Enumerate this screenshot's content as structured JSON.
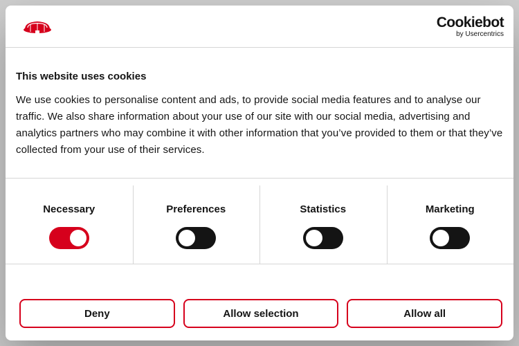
{
  "colors": {
    "accent": "#d6001c",
    "toggle_off": "#141414",
    "divider": "#d6d6d6"
  },
  "header": {
    "brand_icon": "brand-logo-icon",
    "cookiebot_main": "Cookiebot",
    "cookiebot_sub": "by Usercentrics"
  },
  "content": {
    "title": "This website uses cookies",
    "body": "We use cookies to personalise content and ads, to provide social media features and to analyse our traffic. We also share information about your use of our site with our social media, advertising and analytics partners who may combine it with other information that you’ve provided to them or that they’ve collected from your use of their services."
  },
  "categories": [
    {
      "label": "Necessary",
      "enabled": true
    },
    {
      "label": "Preferences",
      "enabled": false
    },
    {
      "label": "Statistics",
      "enabled": false
    },
    {
      "label": "Marketing",
      "enabled": false
    }
  ],
  "buttons": {
    "deny": "Deny",
    "allow_selection": "Allow selection",
    "allow_all": "Allow all"
  }
}
